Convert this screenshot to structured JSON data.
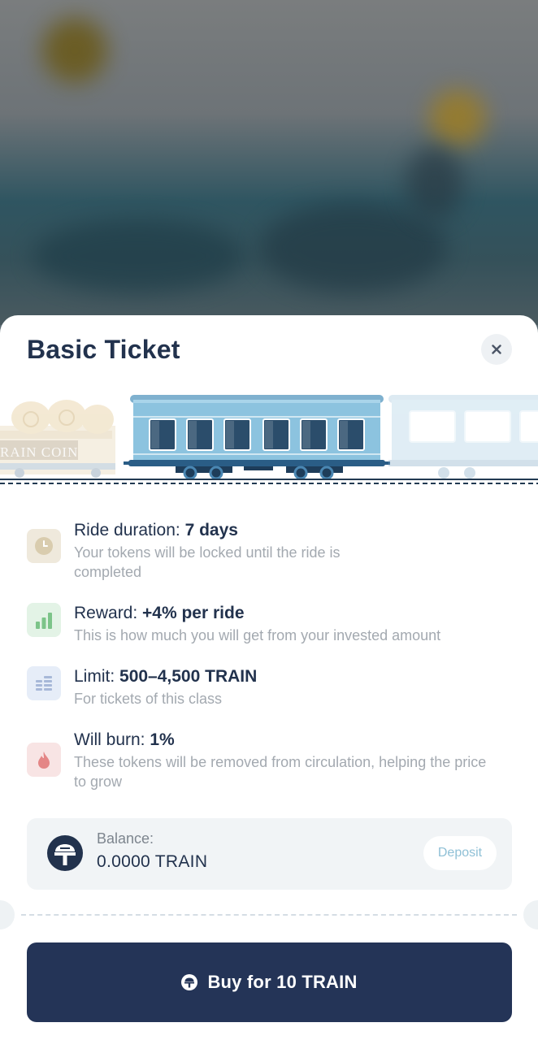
{
  "sheet": {
    "title": "Basic Ticket",
    "close_icon": "close-icon"
  },
  "scene": {
    "wagon_text": "RAIN COIN"
  },
  "info": [
    {
      "icon": "clock-icon",
      "label": "Ride duration: ",
      "value": "7 days",
      "description": "Your tokens will be locked until the ride is completed",
      "icon_bg": "#efe9dc",
      "icon_color": "#cfc2a4"
    },
    {
      "icon": "bar-chart-icon",
      "label": "Reward: ",
      "value": "+4% per ride",
      "description": "This is how much you will get from your invested amount",
      "icon_bg": "#e3f3e6",
      "icon_color": "#86c992"
    },
    {
      "icon": "coin-stack-icon",
      "label": "Limit: ",
      "value": "500–4,500 TRAIN",
      "description": "For tickets of this class",
      "icon_bg": "#e6edf8",
      "icon_color": "#a9b9d6"
    },
    {
      "icon": "flame-icon",
      "label": "Will burn: ",
      "value": "1%",
      "description": "These tokens will be removed from circulation, helping the price to grow",
      "icon_bg": "#f8e4e4",
      "icon_color": "#e58b8b"
    }
  ],
  "balance": {
    "label": "Balance:",
    "value": "0.0000 TRAIN",
    "deposit_label": "Deposit"
  },
  "buy": {
    "label": "Buy for 10 TRAIN"
  },
  "colors": {
    "primary": "#243457",
    "title": "#22324d",
    "muted": "#a3a9b0",
    "accent": "#8fc0d6"
  }
}
